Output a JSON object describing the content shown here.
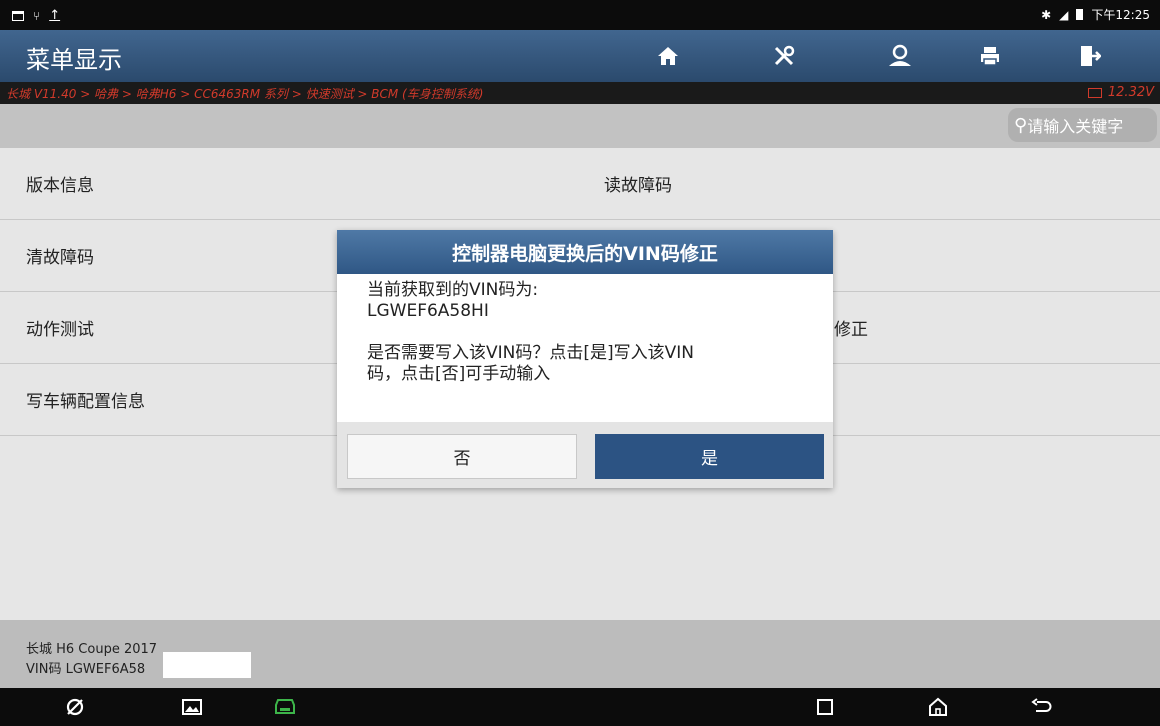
{
  "status_bar": {
    "time": "下午12:25",
    "icons": [
      "image-icon",
      "usb-icon",
      "upload-icon",
      "bluetooth-icon",
      "signal-icon",
      "battery-icon"
    ]
  },
  "header": {
    "title": "菜单显示",
    "toolbar": [
      "home-icon",
      "tools-icon",
      "user-icon",
      "print-icon",
      "exit-icon"
    ]
  },
  "breadcrumb": {
    "path": "长城 V11.40 > 哈弗 > 哈弗H6 > CC6463RM 系列 > 快速测试 > BCM (车身控制系统)",
    "voltage": "12.32V"
  },
  "search": {
    "placeholder": "请输入关键字"
  },
  "menu": {
    "items": [
      "版本信息",
      "读故障码",
      "清故障码",
      "",
      "动作测试",
      "修正",
      "写车辆配置信息",
      ""
    ]
  },
  "footer": {
    "vehicle": "长城 H6 Coupe 2017",
    "vin": "VIN码 LGWEF6A58"
  },
  "dialog": {
    "title": "控制器电脑更换后的VIN码修正",
    "line1": "当前获取到的VIN码为:",
    "line2": "LGWEF6A58HI",
    "line3": "是否需要写入该VIN码？点击[是]写入该VIN",
    "line4": "码，点击[否]可手动输入",
    "no_label": "否",
    "yes_label": "是"
  },
  "colors": {
    "accent": "#2c5383",
    "breadcrumb": "#d13a2b",
    "header": "#34577e"
  }
}
